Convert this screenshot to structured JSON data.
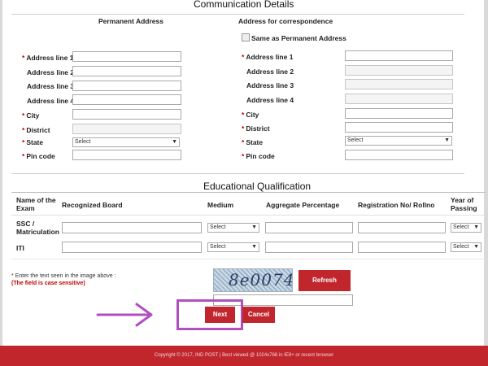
{
  "header": {
    "title": "Communication Details"
  },
  "permanent": {
    "heading": "Permanent Address",
    "fields": [
      {
        "label": "Address line 1",
        "required": true
      },
      {
        "label": "Address line 2",
        "required": false
      },
      {
        "label": "Address line 3",
        "required": false
      },
      {
        "label": "Address line 4",
        "required": false
      },
      {
        "label": "City",
        "required": true
      },
      {
        "label": "District",
        "required": true
      },
      {
        "label": "State",
        "required": true,
        "value": "Select"
      },
      {
        "label": "Pin code",
        "required": true
      }
    ]
  },
  "correspondence": {
    "heading": "Address for correspondence",
    "same_as_label": "Same as Permanent Address",
    "fields": [
      {
        "label": "Address line 1",
        "required": true
      },
      {
        "label": "Address line 2",
        "required": false
      },
      {
        "label": "Address line 3",
        "required": false
      },
      {
        "label": "Address line 4",
        "required": false
      },
      {
        "label": "City",
        "required": true
      },
      {
        "label": "District",
        "required": true
      },
      {
        "label": "State",
        "required": true,
        "value": "Select"
      },
      {
        "label": "Pin code",
        "required": true
      }
    ]
  },
  "education": {
    "title": "Educational Qualification",
    "columns": [
      "Name of the Exam",
      "Recognized Board",
      "Medium",
      "Aggregate Percentage",
      "Registration No/ Rollno",
      "Year of Passing"
    ],
    "rows": [
      {
        "exam": "SSC / Matriculation",
        "medium": "Select",
        "year": "Select"
      },
      {
        "exam": "ITI",
        "medium": "Select",
        "year": "Select"
      }
    ]
  },
  "captcha": {
    "instruction": "Enter the text seen in the image above :",
    "note": "(The field is case sensitive)",
    "image_text": "8e0074",
    "refresh_label": "Refresh"
  },
  "actions": {
    "next_label": "Next",
    "cancel_label": "Cancel"
  },
  "footer": {
    "text": "Copyright © 2017, IND POST | Best viewed @ 1024x768 in IE8+ or recent browser"
  },
  "colors": {
    "brand": "#c0262c",
    "highlight": "#b04fc0"
  }
}
